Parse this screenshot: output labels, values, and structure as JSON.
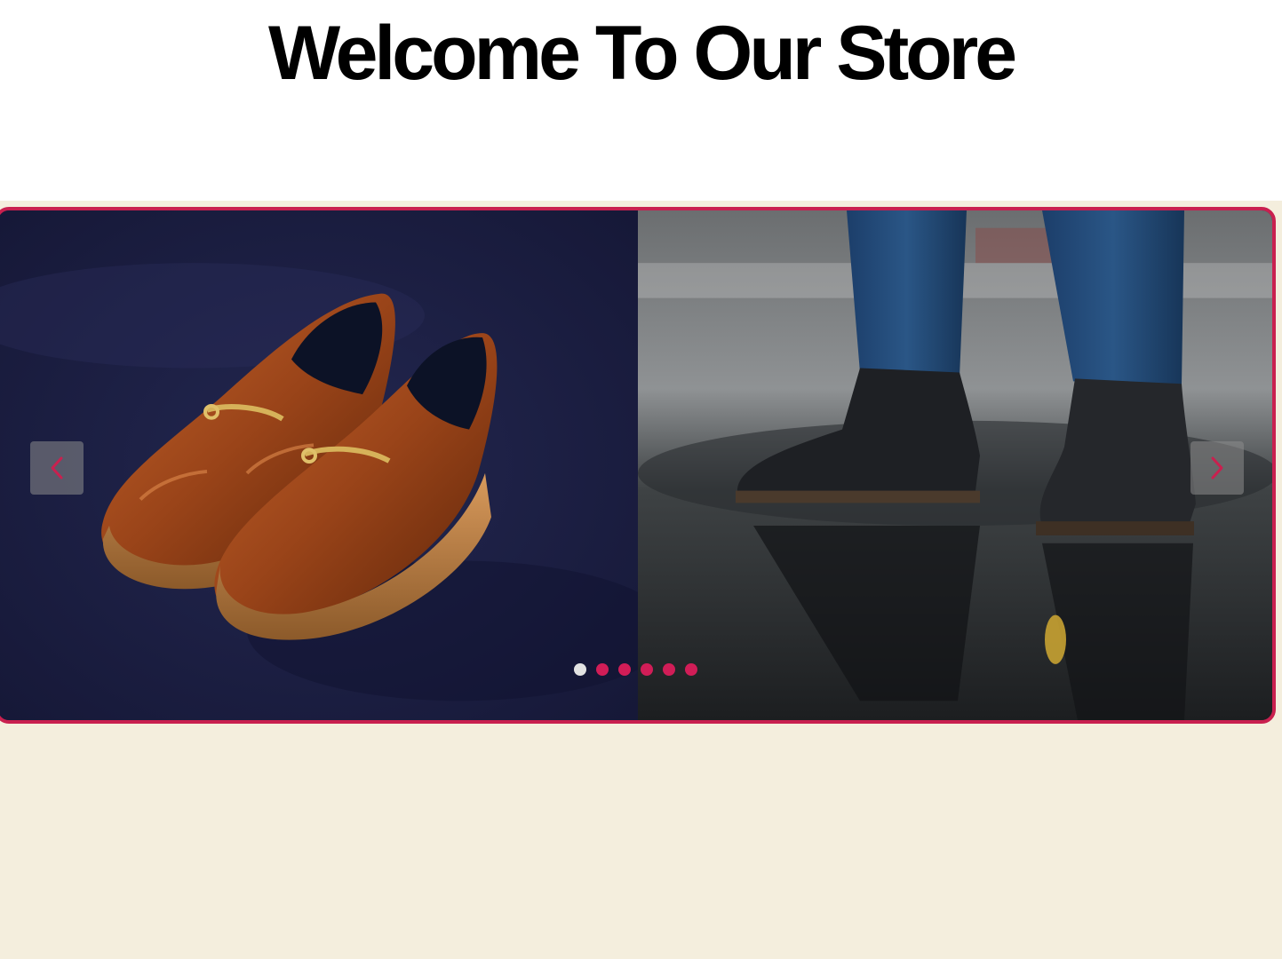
{
  "header": {
    "title": "Welcome To Our Store"
  },
  "carousel": {
    "slides": [
      {
        "alt": "Brown leather horsebit loafers on navy velvet",
        "icon": "loafers-image"
      },
      {
        "alt": "Black leather boots standing in a puddle",
        "icon": "boots-image"
      }
    ],
    "prev_icon": "chevron-left-icon",
    "next_icon": "chevron-right-icon",
    "dot_count": 6,
    "active_dot": 0
  },
  "colors": {
    "accent": "#c9204f",
    "dot": "#d11d57",
    "dot_active": "#e2e2e2",
    "hero_background": "#f4eedd"
  }
}
